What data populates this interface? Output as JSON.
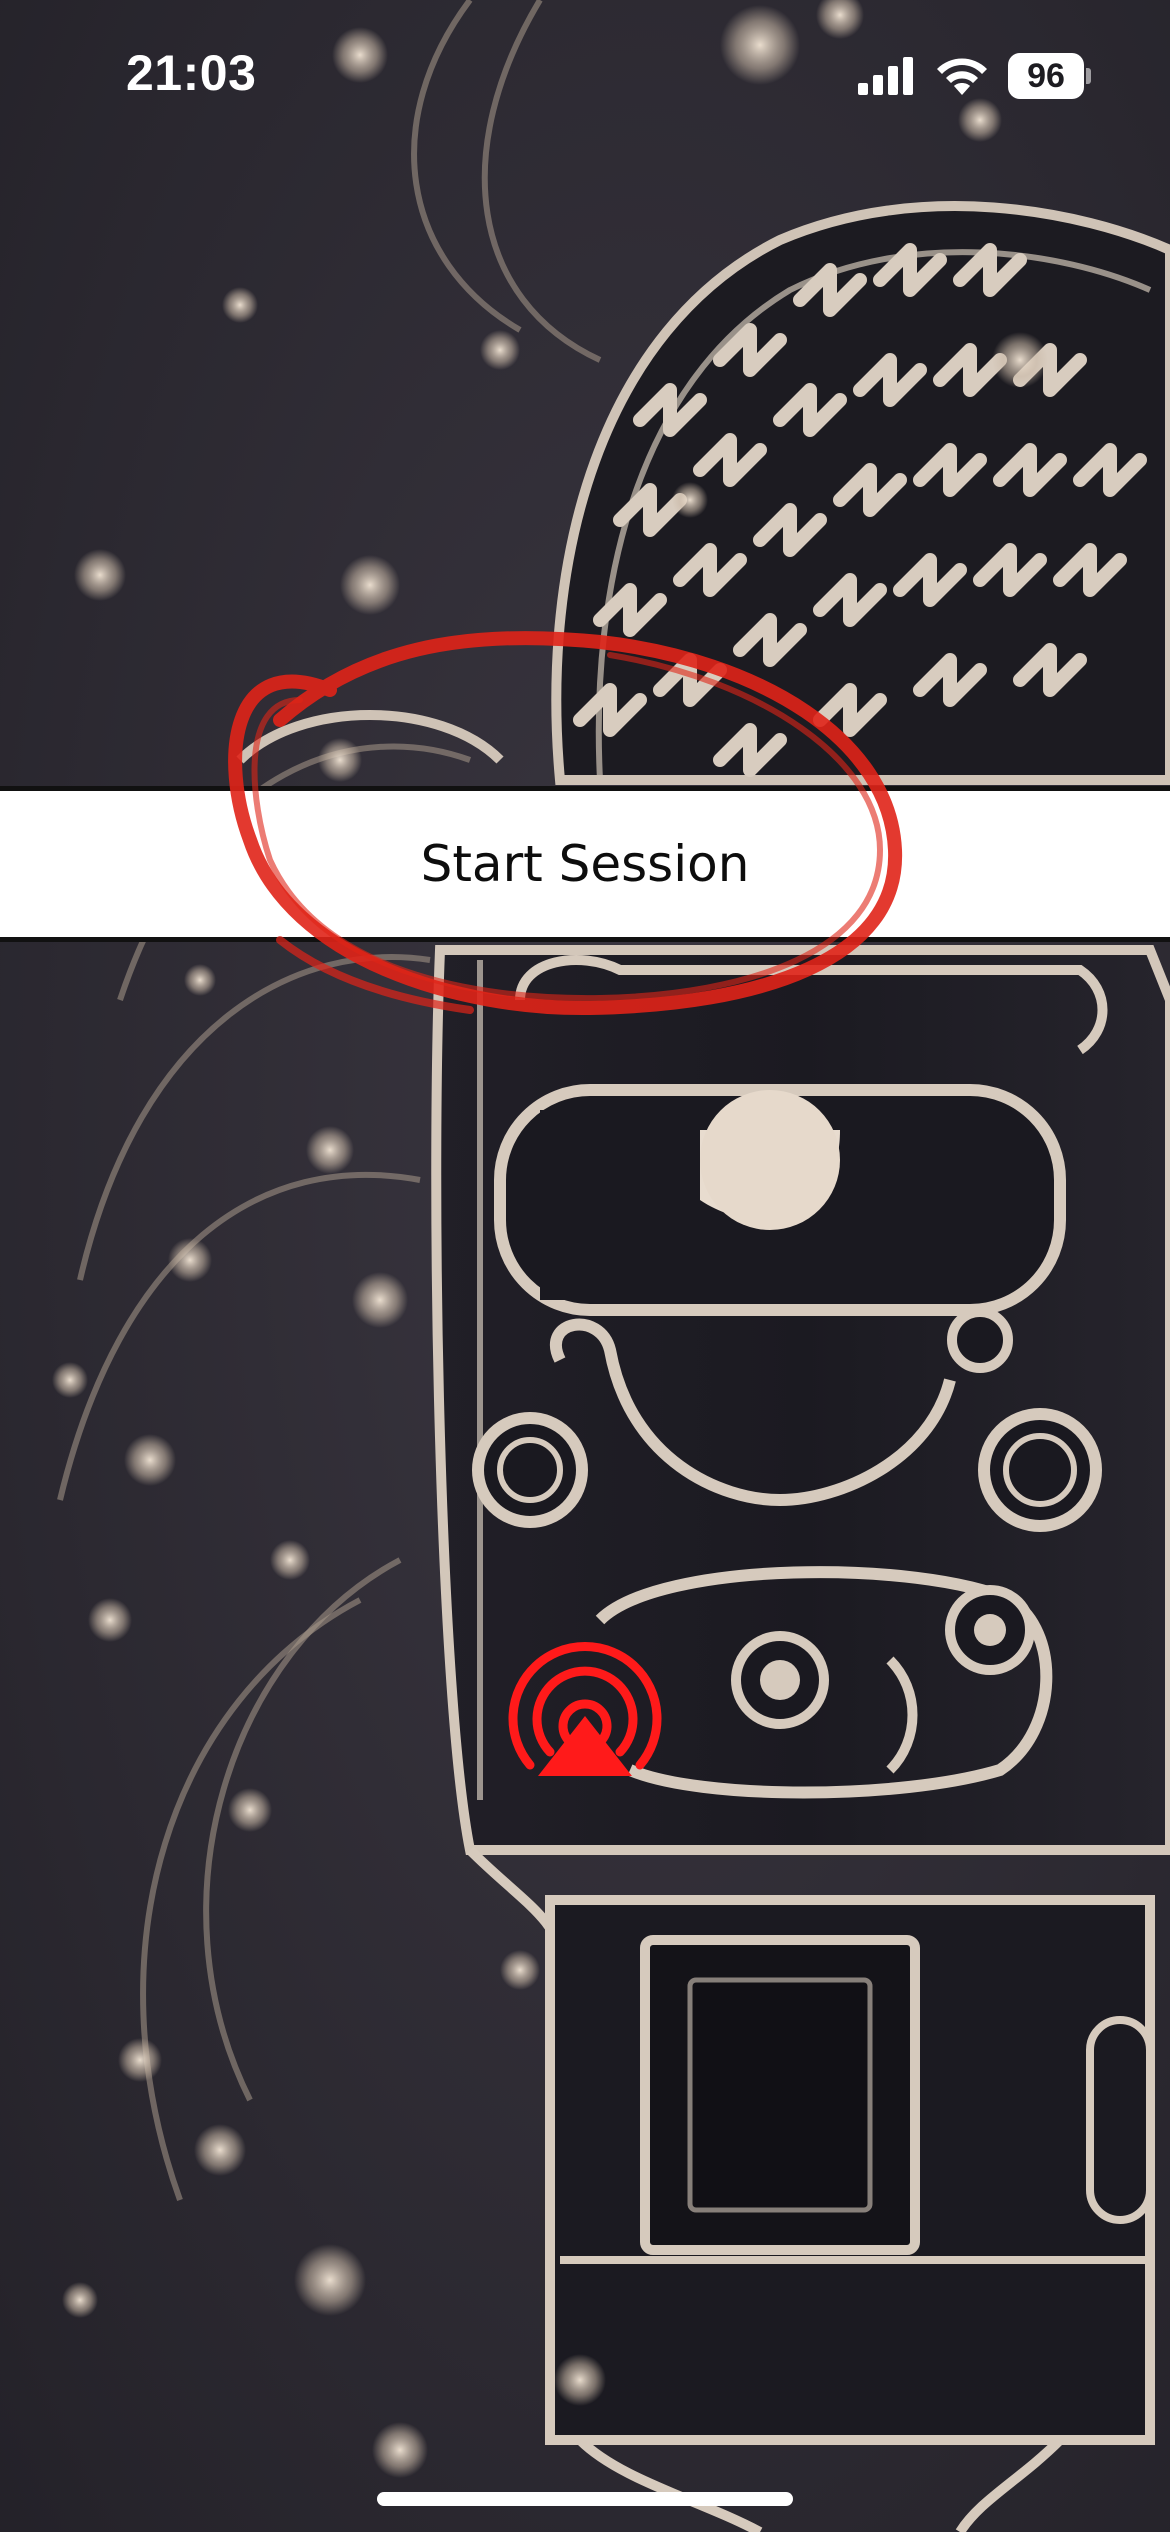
{
  "status_bar": {
    "time": "21:03",
    "battery": "96",
    "icons": [
      "cellular-signal-icon",
      "wifi-icon",
      "battery-icon"
    ]
  },
  "session": {
    "label": "Start Session"
  },
  "airplay": {
    "icon": "airplay-icon",
    "color": "#ff1a1a"
  },
  "annotation": {
    "color": "#e02418"
  },
  "theme": {
    "background": "#2a2830",
    "line_color": "#d9cfc4"
  }
}
